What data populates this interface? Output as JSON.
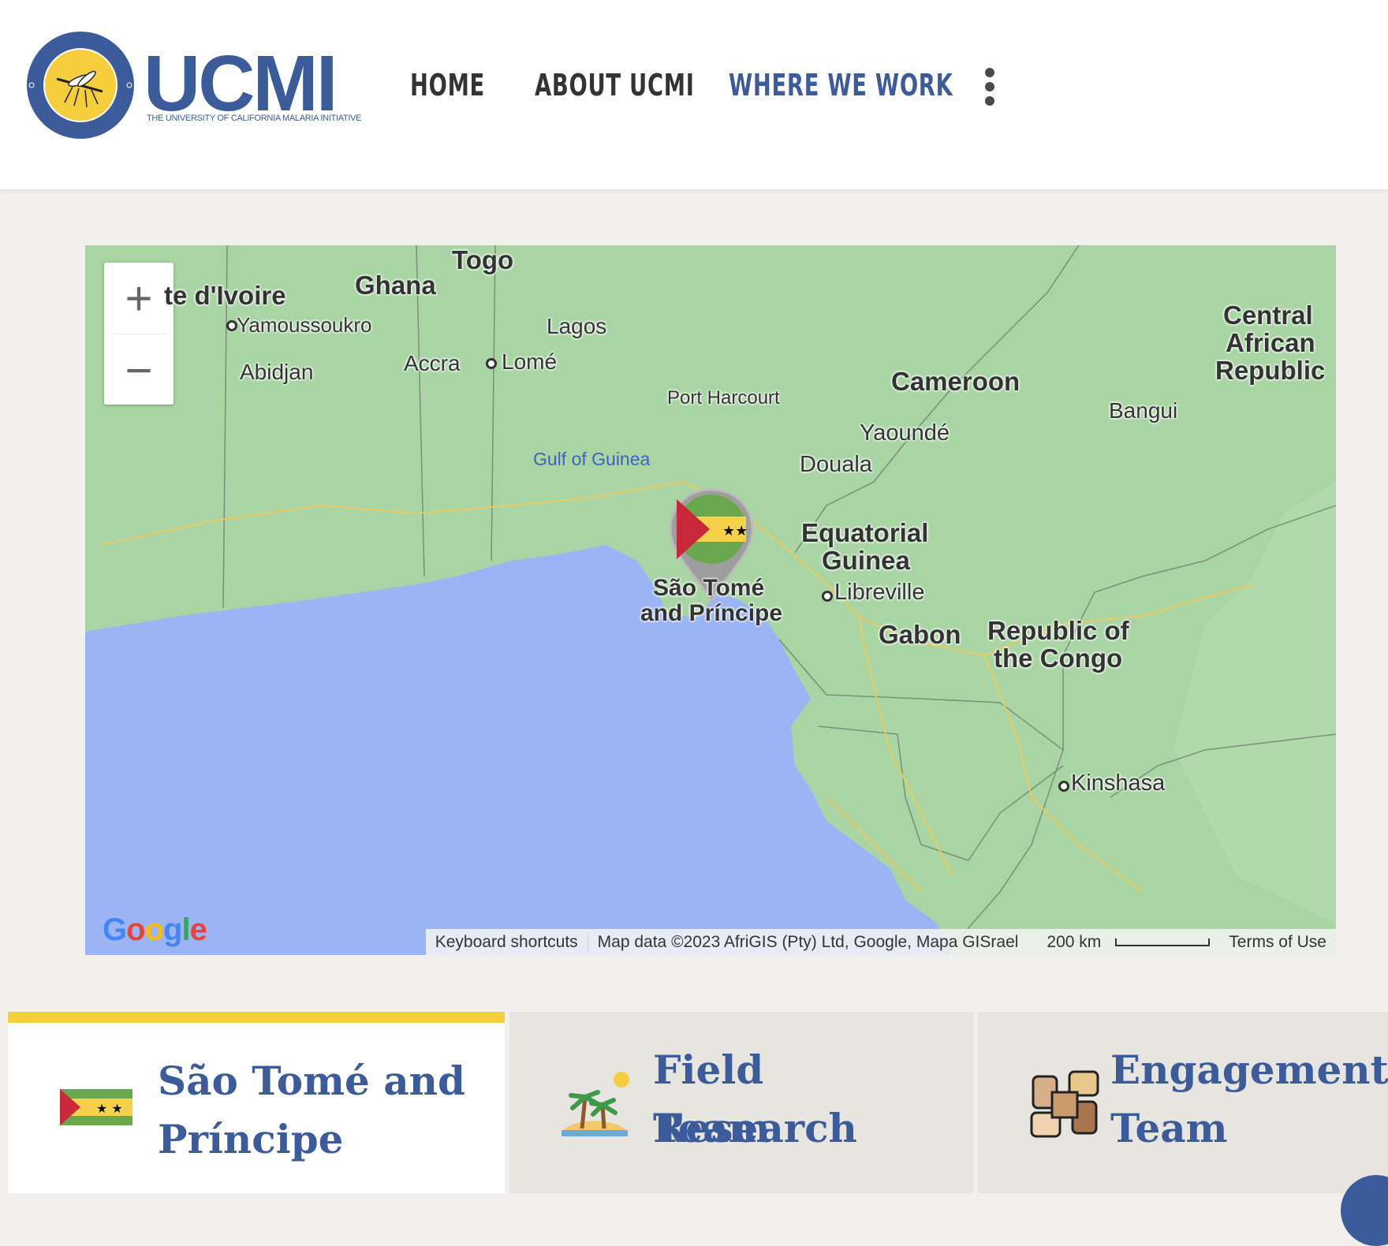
{
  "logo": {
    "wordmark": "UCMI",
    "subtitle": "THE UNIVERSITY OF CALIFORNIA MALARIA INITIATIVE",
    "ring_text": "The University of California Malaria Initiative"
  },
  "nav": {
    "items": [
      {
        "label": "HOME"
      },
      {
        "label": "ABOUT UCMI"
      },
      {
        "label": "WHERE WE WORK"
      }
    ]
  },
  "map": {
    "zoom_in": "+",
    "zoom_out": "−",
    "google": "Google",
    "attribution": {
      "shortcuts": "Keyboard shortcuts",
      "data": "Map data ©2023 AfriGIS (Pty) Ltd, Google, Mapa GISrael",
      "scale": "200 km",
      "terms": "Terms of Use"
    },
    "labels": {
      "cote": "te d'Ivoire",
      "ghana": "Ghana",
      "togo": "Togo",
      "yamoussoukro": "Yamoussoukro",
      "lagos": "Lagos",
      "abidjan": "Abidjan",
      "accra": "Accra",
      "lome": "Lomé",
      "port_harcourt": "Port Harcourt",
      "gulf": "Gulf of Guinea",
      "cameroon": "Cameroon",
      "yaounde": "Yaoundé",
      "douala": "Douala",
      "car1": "Central",
      "car2": "African",
      "car3": "Republic",
      "bangui": "Bangui",
      "eq1": "Equatorial",
      "eq2": "Guinea",
      "libreville": "Libreville",
      "gabon": "Gabon",
      "stp1": "São Tomé",
      "stp2": "and Príncipe",
      "congo1": "Republic of",
      "congo2": "the Congo",
      "kinshasa": "Kinshasa"
    }
  },
  "cards": [
    {
      "title_1": "São Tomé and",
      "title_2": "Príncipe",
      "icon": "sao-tome-flag-icon"
    },
    {
      "title_1": "Field Research",
      "title_2": "Team",
      "icon": "island-icon"
    },
    {
      "title_1": "Engagement",
      "title_2": "Team",
      "icon": "hands-icon"
    }
  ],
  "colors": {
    "brand": "#3b5b9a",
    "accent": "#f4ce3d",
    "ocean": "#9bb4f3",
    "land": "#a8d5a3"
  }
}
